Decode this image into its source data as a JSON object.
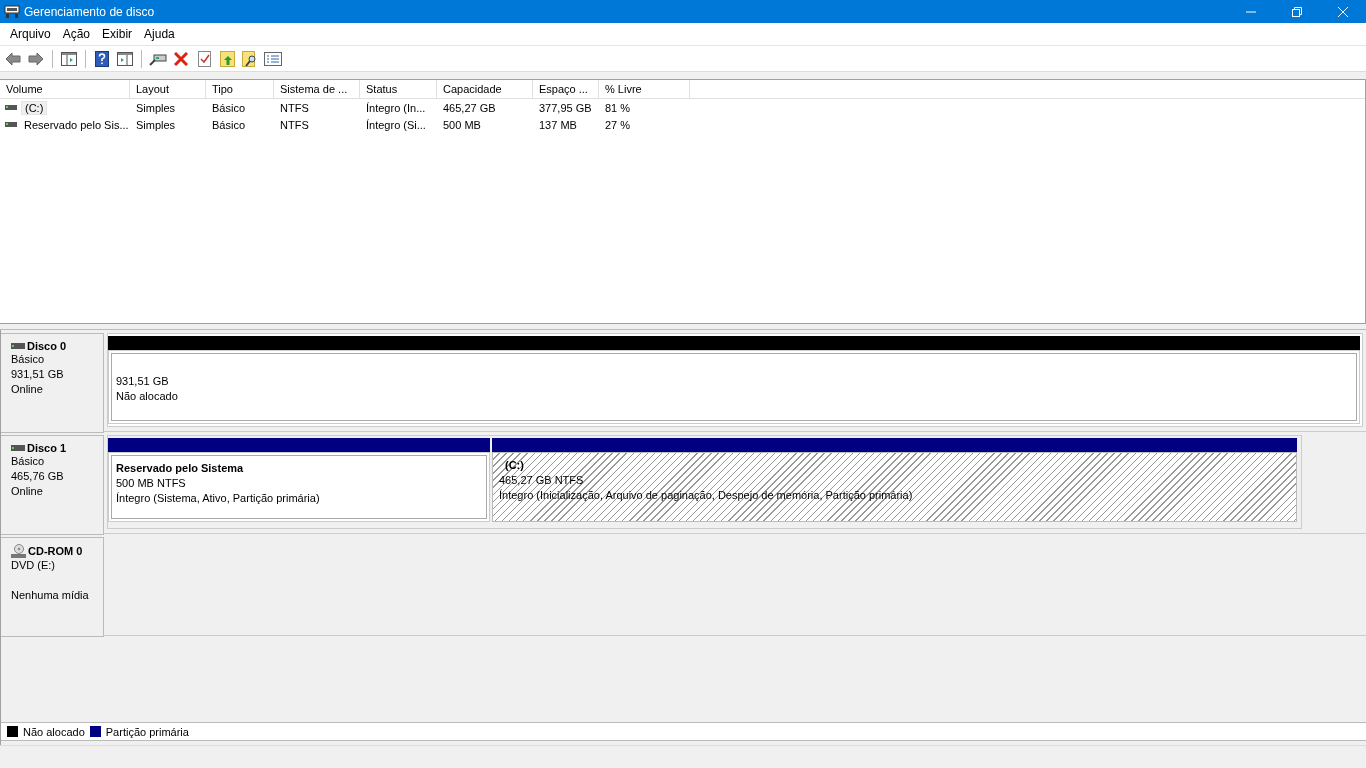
{
  "window": {
    "title": "Gerenciamento de disco"
  },
  "menu": [
    "Arquivo",
    "Ação",
    "Exibir",
    "Ajuda"
  ],
  "volume_table": {
    "columns": [
      "Volume",
      "Layout",
      "Tipo",
      "Sistema de ...",
      "Status",
      "Capacidade",
      "Espaço ...",
      "% Livre"
    ],
    "rows": [
      {
        "selected": true,
        "cells": [
          "(C:)",
          "Simples",
          "Básico",
          "NTFS",
          "Íntegro (In...",
          "465,27 GB",
          "377,95 GB",
          "81 %"
        ]
      },
      {
        "selected": false,
        "cells": [
          "Reservado pelo Sis...",
          "Simples",
          "Básico",
          "NTFS",
          "Íntegro (Si...",
          "500 MB",
          "137 MB",
          "27 %"
        ]
      }
    ]
  },
  "disks": [
    {
      "kind": "disk",
      "name": "Disco 0",
      "lines": [
        "Básico",
        "931,51 GB",
        "Online"
      ],
      "partitions": [
        {
          "kind": "unallocated",
          "selected": false,
          "lines": [
            "931,51 GB",
            "Não alocado"
          ]
        }
      ]
    },
    {
      "kind": "disk",
      "name": "Disco 1",
      "lines": [
        "Básico",
        "465,76 GB",
        "Online"
      ],
      "partitions": [
        {
          "kind": "primary",
          "selected": false,
          "title": "Reservado pelo Sistema",
          "lines": [
            "500 MB NTFS",
            "Íntegro (Sistema, Ativo, Partição primária)"
          ]
        },
        {
          "kind": "primary",
          "selected": true,
          "title": "(C:)",
          "lines": [
            "465,27 GB NTFS",
            "Íntegro (Inicialização, Arquivo de paginação, Despejo de memória, Partição primária)"
          ]
        }
      ]
    },
    {
      "kind": "cdrom",
      "name": "CD-ROM 0",
      "lines": [
        "DVD (E:)",
        "Nenhuma mídia"
      ]
    }
  ],
  "legend": [
    {
      "label": "Não alocado",
      "color": "#000000"
    },
    {
      "label": "Partição primária",
      "color": "#000080"
    }
  ]
}
